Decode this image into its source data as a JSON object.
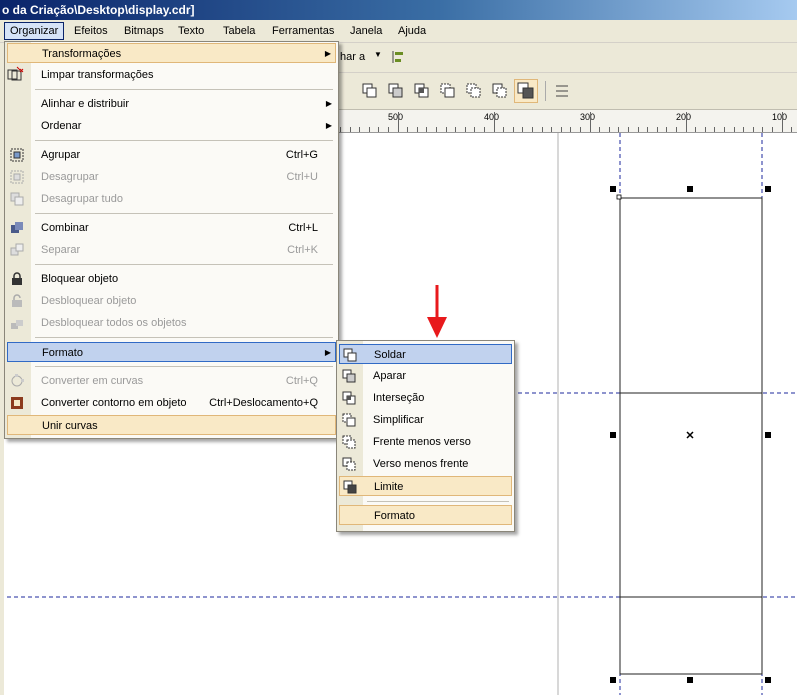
{
  "window": {
    "title": "o da Criação\\Desktop\\display.cdr]"
  },
  "menubar": {
    "items": [
      {
        "label": "Organizar"
      },
      {
        "label": "Efeitos"
      },
      {
        "label": "Bitmaps"
      },
      {
        "label": "Texto"
      },
      {
        "label": "Tabela"
      },
      {
        "label": "Ferramentas"
      },
      {
        "label": "Janela"
      },
      {
        "label": "Ajuda"
      }
    ]
  },
  "toolbar": {
    "partial_label": "har a"
  },
  "ruler": {
    "labels": [
      "500",
      "400",
      "300",
      "200",
      "100"
    ]
  },
  "organizar_menu": {
    "items": [
      {
        "label": "Transformações",
        "shortcut": ""
      },
      {
        "label": "Limpar transformações",
        "shortcut": ""
      },
      {
        "label": "Alinhar e distribuir",
        "shortcut": ""
      },
      {
        "label": "Ordenar",
        "shortcut": ""
      },
      {
        "label": "Agrupar",
        "shortcut": "Ctrl+G"
      },
      {
        "label": "Desagrupar",
        "shortcut": "Ctrl+U"
      },
      {
        "label": "Desagrupar tudo",
        "shortcut": ""
      },
      {
        "label": "Combinar",
        "shortcut": "Ctrl+L"
      },
      {
        "label": "Separar",
        "shortcut": "Ctrl+K"
      },
      {
        "label": "Bloquear objeto",
        "shortcut": ""
      },
      {
        "label": "Desbloquear objeto",
        "shortcut": ""
      },
      {
        "label": "Desbloquear todos os objetos",
        "shortcut": ""
      },
      {
        "label": "Formato",
        "shortcut": ""
      },
      {
        "label": "Converter em curvas",
        "shortcut": "Ctrl+Q"
      },
      {
        "label": "Converter contorno em objeto",
        "shortcut": "Ctrl+Deslocamento+Q"
      },
      {
        "label": "Unir curvas",
        "shortcut": ""
      }
    ]
  },
  "formato_submenu": {
    "items": [
      {
        "label": "Soldar"
      },
      {
        "label": "Aparar"
      },
      {
        "label": "Interseção"
      },
      {
        "label": "Simplificar"
      },
      {
        "label": "Frente menos verso"
      },
      {
        "label": "Verso menos frente"
      },
      {
        "label": "Limite"
      },
      {
        "label": "Formato"
      }
    ]
  },
  "colors": {
    "highlight": "#f9e9c6",
    "selected": "#c1d2ee",
    "arrow": "#e8191c",
    "guide": "#1c2a9c"
  }
}
